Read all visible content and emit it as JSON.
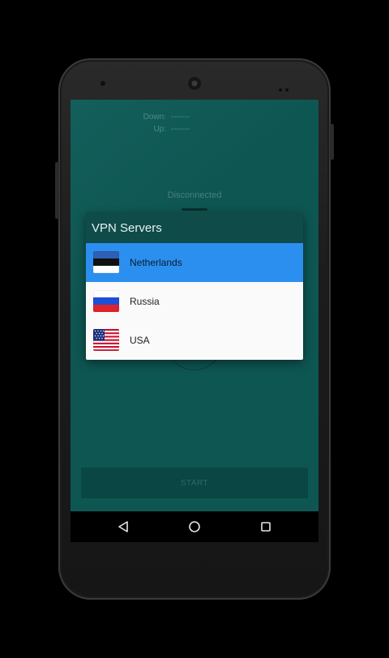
{
  "stats": {
    "down_label": "Down:",
    "down_value": "-------",
    "up_label": "Up:",
    "up_value": "-------"
  },
  "status": {
    "text": "Disconnected"
  },
  "dialog": {
    "title": "VPN Servers",
    "servers": [
      {
        "label": "Netherlands",
        "flag": "estonia-flag-icon",
        "selected": true
      },
      {
        "label": "Russia",
        "flag": "russia-flag-icon",
        "selected": false
      },
      {
        "label": "USA",
        "flag": "usa-flag-icon",
        "selected": false
      }
    ]
  },
  "start_button": {
    "label": "START"
  },
  "colors": {
    "accent_selected": "#2b8ff0",
    "screen_bg": "#0e5652",
    "dialog_header": "#0f4b48"
  },
  "navbar": {
    "icons": [
      "back-icon",
      "home-icon",
      "recent-apps-icon"
    ]
  }
}
